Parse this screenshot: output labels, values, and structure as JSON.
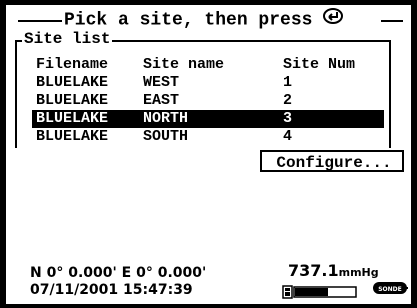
{
  "header": {
    "instruction": "Pick a site, then press"
  },
  "site_list": {
    "caption": "Site list",
    "columns": [
      "Filename",
      "Site name",
      "Site Num"
    ],
    "rows": [
      {
        "filename": "BLUELAKE",
        "site_name": "WEST",
        "site_num": "1",
        "selected": false
      },
      {
        "filename": "BLUELAKE",
        "site_name": "EAST",
        "site_num": "2",
        "selected": false
      },
      {
        "filename": "BLUELAKE",
        "site_name": "NORTH",
        "site_num": "3",
        "selected": true
      },
      {
        "filename": "BLUELAKE",
        "site_name": "SOUTH",
        "site_num": "4",
        "selected": false
      }
    ]
  },
  "buttons": {
    "configure": "Configure..."
  },
  "status": {
    "gps": "N 0° 0.000' E  0° 0.000'",
    "datetime": "07/11/2001 15:47:39",
    "pressure_value": "737.1",
    "pressure_unit": "mmHg",
    "battery_level": 0.55,
    "logo_text": "SONDE"
  },
  "colors": {
    "foreground": "#000000",
    "background": "#ffffff"
  }
}
